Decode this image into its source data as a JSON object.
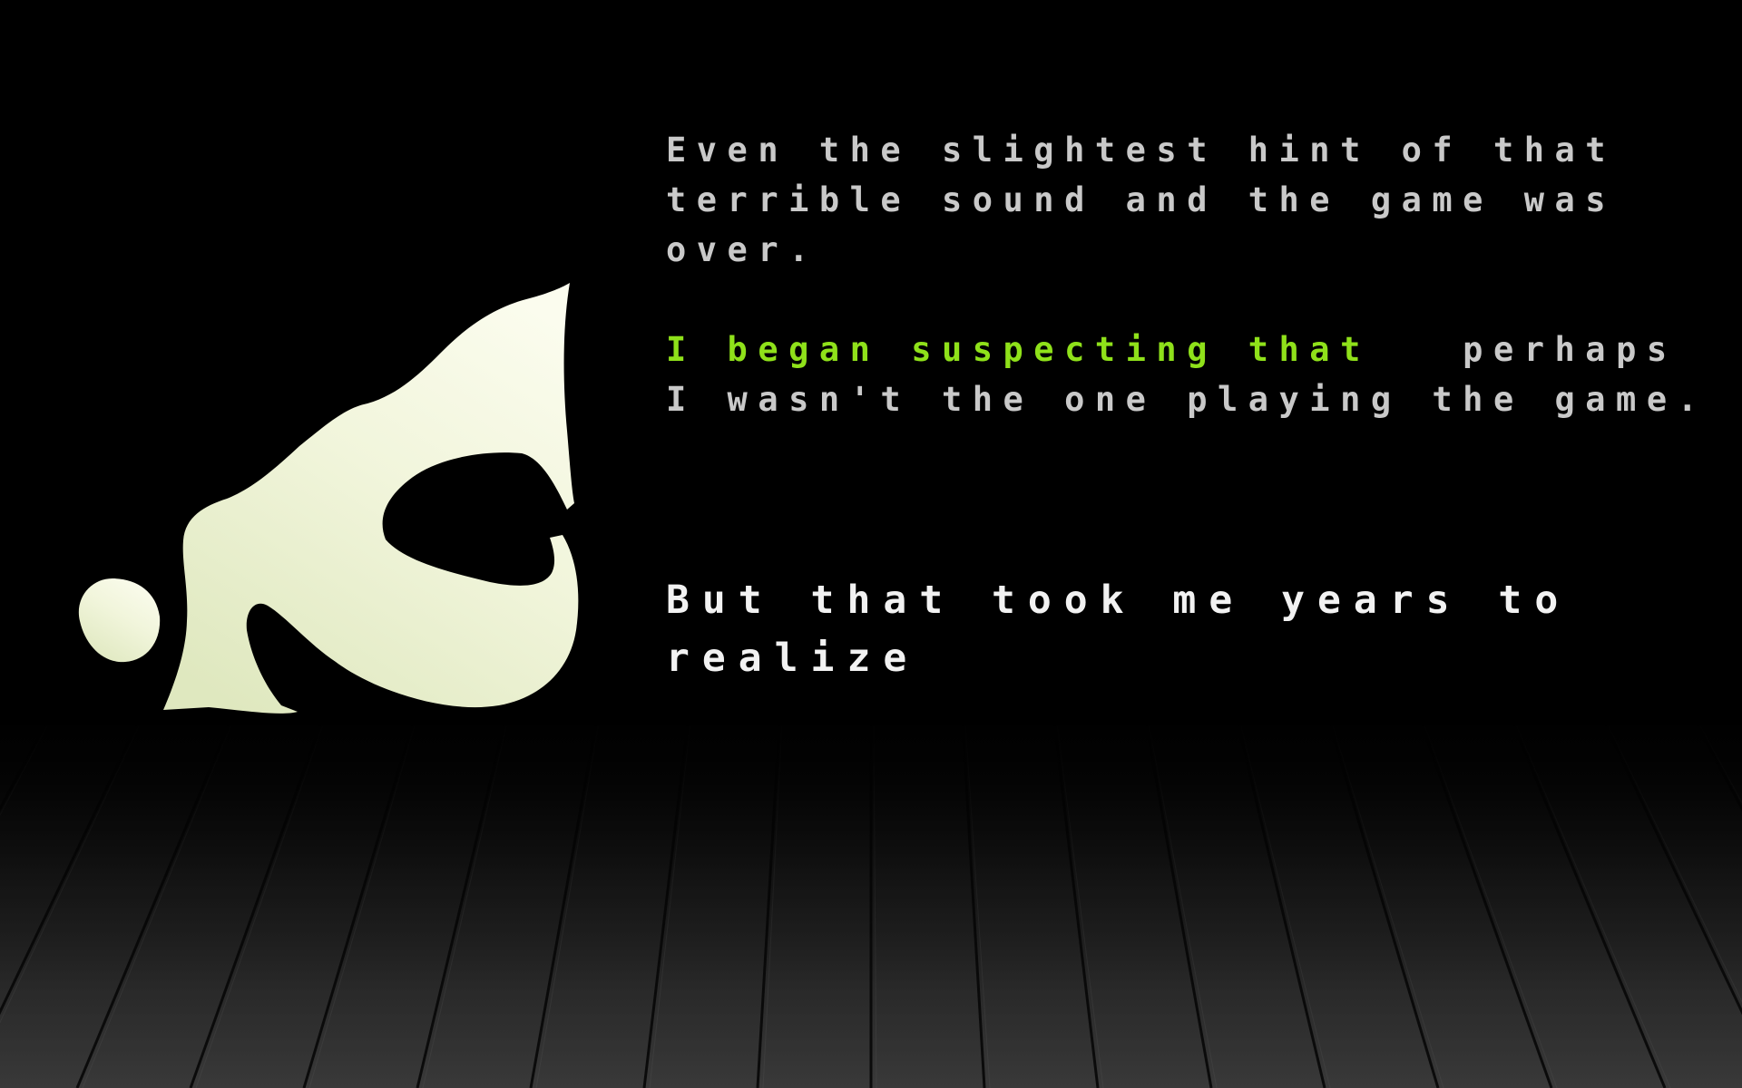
{
  "narration": {
    "paragraph1": "Even the slightest hint of that terrible sound and the game was over.",
    "paragraph2": {
      "highlighted": "I began suspecting that",
      "rest": "   perhaps I wasn't the one playing the game."
    },
    "paragraph3": "But that took me years to realize"
  },
  "colors": {
    "background": "#000000",
    "narration_text": "#c9c9c9",
    "highlight_text": "#8fe11a",
    "emphasis_text": "#f2f2f2",
    "symbol_fill": "#f4f7de"
  },
  "icons": {
    "symbol": "glowing-glyph-icon"
  }
}
